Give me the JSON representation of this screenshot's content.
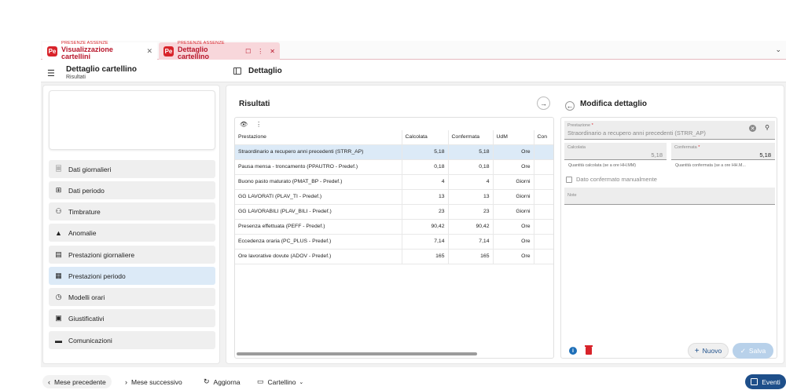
{
  "tabs": [
    {
      "category": "PRESENZE ASSENZE",
      "title": "Visualizzazione cartellini",
      "logo": "Pe"
    },
    {
      "category": "PRESENZE ASSENZE",
      "title": "Dettaglio cartellino",
      "logo": "Pe"
    }
  ],
  "header": {
    "title": "Dettaglio cartellino",
    "subtitle": "Risultati",
    "right_title": "Dettaglio"
  },
  "sidebar": {
    "items": [
      {
        "label": "Dati giornalieri",
        "icon": "document-icon"
      },
      {
        "label": "Dati periodo",
        "icon": "grid-icon"
      },
      {
        "label": "Timbrature",
        "icon": "badge-icon"
      },
      {
        "label": "Anomalie",
        "icon": "warning-icon"
      },
      {
        "label": "Prestazioni giornaliere",
        "icon": "file-icon"
      },
      {
        "label": "Prestazioni periodo",
        "icon": "calendar-icon",
        "active": true
      },
      {
        "label": "Modelli orari",
        "icon": "clock-calendar-icon"
      },
      {
        "label": "Giustificativi",
        "icon": "file-plus-icon"
      },
      {
        "label": "Comunicazioni",
        "icon": "message-icon"
      }
    ]
  },
  "results": {
    "title": "Risultati",
    "columns": [
      "Prestazione",
      "Calcolata",
      "Confermata",
      "UdM",
      "Con"
    ],
    "rows": [
      {
        "prestazione": "Straordinario a recupero anni precedenti (STRR_AP)",
        "calcolata": "5,18",
        "confermata": "5,18",
        "udm": "Ore",
        "selected": true
      },
      {
        "prestazione": "Pausa mensa - troncamento (PPAUTRO - Predef.)",
        "calcolata": "0,18",
        "confermata": "0,18",
        "udm": "Ore"
      },
      {
        "prestazione": "Buono pasto maturato (PMAT_BP - Predef.)",
        "calcolata": "4",
        "confermata": "4",
        "udm": "Giorni"
      },
      {
        "prestazione": "GG LAVORATI (PLAV_TI - Predef.)",
        "calcolata": "13",
        "confermata": "13",
        "udm": "Giorni"
      },
      {
        "prestazione": "GG LAVORABILI (PLAV_BILI - Predef.)",
        "calcolata": "23",
        "confermata": "23",
        "udm": "Giorni"
      },
      {
        "prestazione": "Presenza effettuata (PEFF - Predef.)",
        "calcolata": "90,42",
        "confermata": "90,42",
        "udm": "Ore"
      },
      {
        "prestazione": "Eccedenza oraria (PC_PLUS - Predef.)",
        "calcolata": "7,14",
        "confermata": "7,14",
        "udm": "Ore"
      },
      {
        "prestazione": "Ore lavorative dovute (ADOV - Predef.)",
        "calcolata": "165",
        "confermata": "165",
        "udm": "Ore"
      }
    ]
  },
  "detail": {
    "title": "Modifica dettaglio",
    "prestazione_label": "Prestazione",
    "prestazione_value": "Straordinario a recupero anni precedenti (STRR_AP)",
    "calcolata_label": "Calcolata",
    "calcolata_value": "5,18",
    "calcolata_hint": "Quantità calcolata (se a ore HH.MM)",
    "confermata_label": "Confermata",
    "confermata_value": "5,18",
    "confermata_hint": "Quantità confermata (se a ore HH.M...",
    "checkbox_label": "Dato confermato manualmente",
    "note_label": "Note",
    "new_label": "Nuovo",
    "save_label": "Salva"
  },
  "footer": {
    "prev_label": "Mese precedente",
    "next_label": "Mese successivo",
    "refresh_label": "Aggiorna",
    "card_label": "Cartellino",
    "events_label": "Eventi"
  },
  "colors": {
    "brand_red": "#d8232a",
    "accent_blue": "#1e4f8a",
    "selection": "#dceaf7"
  }
}
